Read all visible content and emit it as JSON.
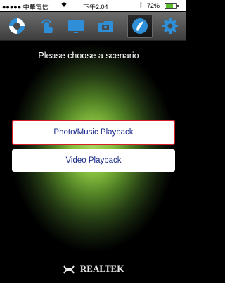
{
  "status_bar": {
    "carrier": "●●●●● 中華電信",
    "time": "下午2:04",
    "battery": "72%",
    "battery_level": 0.72
  },
  "toolbar": {
    "items": [
      {
        "icon": "lifebuoy-icon"
      },
      {
        "icon": "tap-finger-icon"
      },
      {
        "icon": "display-icon"
      },
      {
        "icon": "media-folder-icon"
      },
      {
        "icon": "scenario-icon",
        "active": true
      },
      {
        "icon": "gear-icon"
      }
    ]
  },
  "main": {
    "prompt": "Please choose a scenario",
    "options": [
      {
        "label": "Photo/Music Playback",
        "selected": true
      },
      {
        "label": "Video Playback",
        "selected": false
      }
    ]
  },
  "footer": {
    "brand": "REALTEK"
  },
  "colors": {
    "accent_selected": "#d8202c",
    "icon_blue": "#2e8fd8",
    "glow_green": "#86bf3f"
  }
}
